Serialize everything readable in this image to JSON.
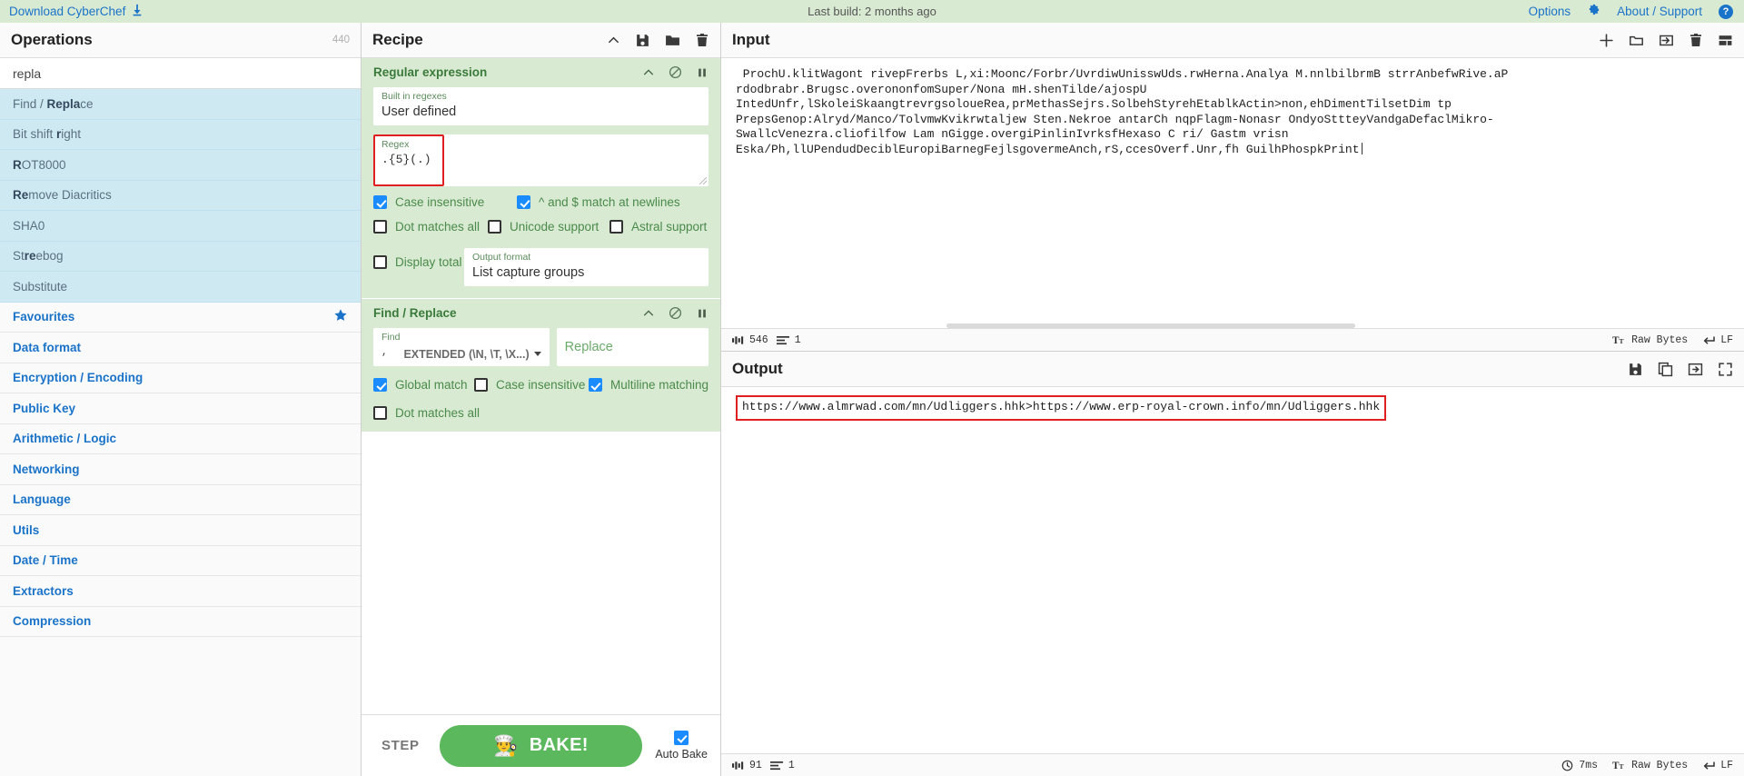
{
  "banner": {
    "download_label": "Download CyberChef",
    "download_icon": "download-arrow-icon",
    "last_build": "Last build: 2 months ago",
    "options_label": "Options",
    "options_icon": "gear-icon",
    "about_label": "About / Support",
    "help_icon": "question-mark-icon",
    "bg_color": "#d9ead3",
    "link_color": "#1a73c8"
  },
  "operations": {
    "title": "Operations",
    "count": "440",
    "search_value": "repla",
    "search_placeholder": "Search...",
    "results": [
      {
        "pre": "Find / ",
        "match": "Repla",
        "post": "ce"
      },
      {
        "pre": "Bit shift ",
        "match": "r",
        "post": "ight"
      },
      {
        "pre": "",
        "match": "R",
        "post": "OT8000"
      },
      {
        "pre": "",
        "match": "Re",
        "post": "move Diacritics"
      },
      {
        "pre": "SHA0",
        "match": "",
        "post": ""
      },
      {
        "pre": "St",
        "match": "re",
        "post": "ebog"
      },
      {
        "pre": "Substitute",
        "match": "",
        "post": ""
      }
    ],
    "categories": [
      {
        "label": "Favourites",
        "starred": true,
        "star_icon": "star-icon"
      },
      {
        "label": "Data format",
        "starred": false
      },
      {
        "label": "Encryption / Encoding",
        "starred": false
      },
      {
        "label": "Public Key",
        "starred": false
      },
      {
        "label": "Arithmetic / Logic",
        "starred": false
      },
      {
        "label": "Networking",
        "starred": false
      },
      {
        "label": "Language",
        "starred": false
      },
      {
        "label": "Utils",
        "starred": false
      },
      {
        "label": "Date / Time",
        "starred": false
      },
      {
        "label": "Extractors",
        "starred": false
      },
      {
        "label": "Compression",
        "starred": false
      }
    ]
  },
  "recipe": {
    "title": "Recipe",
    "toolbar": [
      {
        "name": "collapse-chevron-icon"
      },
      {
        "name": "save-recipe-icon"
      },
      {
        "name": "load-recipe-icon"
      },
      {
        "name": "clear-recipe-icon"
      }
    ],
    "operations": [
      {
        "name": "Regular expression",
        "builtin_label": "Built in regexes",
        "builtin_value": "User defined",
        "regex_label": "Regex",
        "regex_value": ".{5}(.)",
        "regex_highlighted": true,
        "output_format_label": "Output format",
        "output_format_value": "List capture groups",
        "checkboxes": [
          {
            "label": "Case insensitive",
            "checked": true
          },
          {
            "label": "^ and $ match at newlines",
            "checked": true
          },
          {
            "label": "Dot matches all",
            "checked": false
          },
          {
            "label": "Unicode support",
            "checked": false
          },
          {
            "label": "Astral support",
            "checked": false
          },
          {
            "label": "Display total",
            "checked": false
          }
        ]
      },
      {
        "name": "Find / Replace",
        "find_label": "Find",
        "find_value": "",
        "find_mode": "EXTENDED (\\N, \\T, \\X...)",
        "replace_placeholder": "Replace",
        "replace_value": "",
        "checkboxes": [
          {
            "label": "Global match",
            "checked": true
          },
          {
            "label": "Case insensitive",
            "checked": false
          },
          {
            "label": "Multiline matching",
            "checked": true
          },
          {
            "label": "Dot matches all",
            "checked": false
          }
        ]
      }
    ],
    "footer": {
      "step_label": "STEP",
      "bake_label": "BAKE!",
      "bake_icon": "chef-icon",
      "autobake_label": "Auto Bake",
      "autobake_checked": true,
      "bake_color": "#5cb85c"
    }
  },
  "input": {
    "title": "Input",
    "toolbar": [
      {
        "name": "add-input-tab-icon"
      },
      {
        "name": "open-folder-icon"
      },
      {
        "name": "open-folder-as-input-icon"
      },
      {
        "name": "clear-input-icon"
      },
      {
        "name": "reset-layout-icon"
      }
    ],
    "lines": [
      " ProchU.klitWagont rivepFrerbs L,xi:Moonc/Forbr/UvrdiwUnisswUds.rwHerna.Analya M.nnlbilbrmB strrAnbefwRive.aP",
      "rdodbrabr.Brugsc.overononfomSuper/Nona mH.shenTilde/ajospU",
      "IntedUnfr,lSkoleiSkaangtrevrgsoloueRea,prMethasSejrs.SolbehStyrehEtablkActin>non,ehDimentTilsetDim tp",
      "PrepsGenop:Alryd/Manco/TolvmwKvikrwtaljew Sten.Nekroe antarCh nqpFlagm-Nonasr OndyoSttteyVandgaDefaclMikro-",
      "SwallcVenezra.cliofilfow Lam nGigge.overgiPinlinIvrksfHexaso C ri/ Gastm vrisn",
      "Eska/Ph,llUPendudDeciblEuropiBarnegFejlsgovermeAnch,rS,ccesOverf.Unr,fh GuilhPhospkPrint"
    ],
    "status": {
      "length_icon": "abc-icon",
      "length": "546",
      "lines_icon": "lines-icon",
      "lines": "1",
      "font_icon": "font-size-icon",
      "encoding": "Raw Bytes",
      "eol_icon": "return-icon",
      "eol": "LF"
    }
  },
  "output": {
    "title": "Output",
    "toolbar": [
      {
        "name": "save-output-icon"
      },
      {
        "name": "copy-output-icon"
      },
      {
        "name": "replace-input-with-output-icon"
      },
      {
        "name": "maximise-output-icon"
      }
    ],
    "text": "https://www.almrwad.com/mn/Udliggers.hhk>https://www.erp-royal-crown.info/mn/Udliggers.hhk",
    "highlighted": true,
    "highlight_color": "#e02020",
    "status": {
      "length_icon": "abc-icon",
      "length": "91",
      "lines_icon": "lines-icon",
      "lines": "1",
      "timer_icon": "clock-icon",
      "duration": "7ms",
      "font_icon": "font-size-icon",
      "encoding": "Raw Bytes",
      "eol_icon": "return-icon",
      "eol": "LF"
    }
  }
}
